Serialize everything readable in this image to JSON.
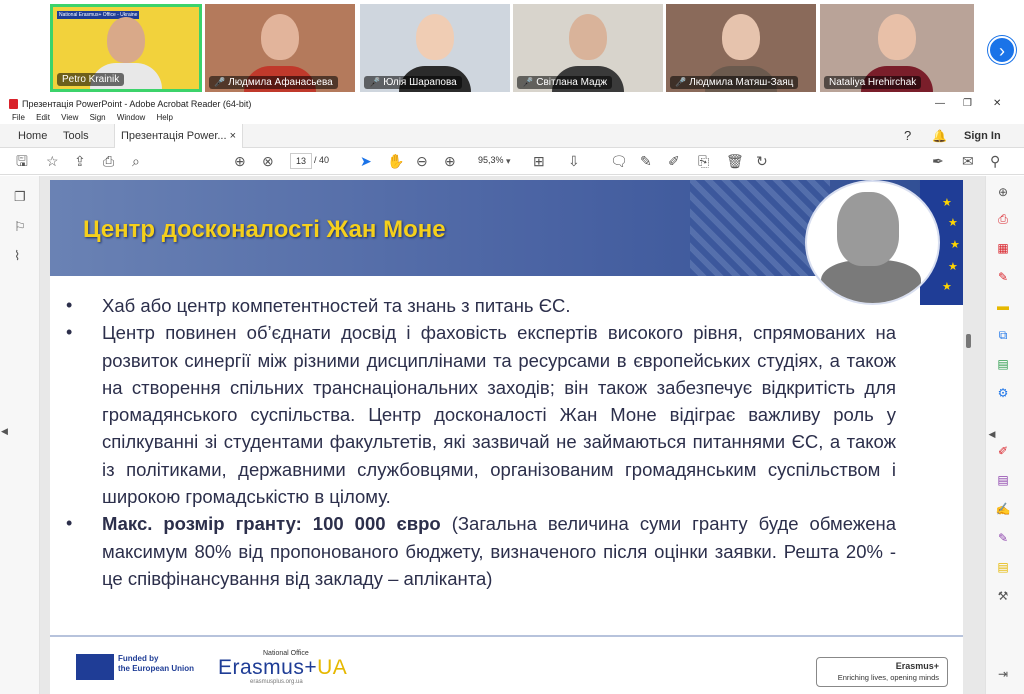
{
  "participants": [
    {
      "name": "Petro Krainik",
      "muted": false,
      "active": true,
      "bg": "#f2d23c",
      "face": "#d9a989",
      "shirt": "#e8e8e8",
      "overlay": "National Erasmus+ Office - Ukraine"
    },
    {
      "name": "Людмила Афанасьева",
      "muted": true,
      "active": false,
      "bg": "#b47a5c",
      "face": "#e2b49b",
      "shirt": "#c0392b"
    },
    {
      "name": "Юлія Шарапова",
      "muted": true,
      "active": false,
      "bg": "#cfd6de",
      "face": "#f0cdb4",
      "shirt": "#2b2b2b"
    },
    {
      "name": "Світлана Мадж",
      "muted": true,
      "active": false,
      "bg": "#d8d4cc",
      "face": "#d9b39a",
      "shirt": "#3a3a3a"
    },
    {
      "name": "Людмила Матяш-Заяц",
      "muted": true,
      "active": false,
      "bg": "#8a6a5a",
      "face": "#e6c3ad",
      "shirt": "#6b5a4e"
    },
    {
      "name": "Nataliya Hrehirchak",
      "muted": false,
      "active": false,
      "bg": "#b9a398",
      "face": "#e8c0a8",
      "shirt": "#7a1e2a"
    }
  ],
  "window": {
    "title": "Презентація PowerPoint - Adobe Acrobat Reader (64-bit)"
  },
  "menu": [
    "File",
    "Edit",
    "View",
    "Sign",
    "Window",
    "Help"
  ],
  "tabs": {
    "home": "Home",
    "tools": "Tools",
    "doc": "Презентація Power...",
    "close": "×",
    "signin": "Sign In"
  },
  "toolbar": {
    "page_current": "13",
    "page_total": "/ 40",
    "zoom": "95,3%"
  },
  "slide": {
    "title": "Центр досконалості Жан Моне",
    "bullets": [
      {
        "bold": "",
        "text": "Хаб або центр компетентностей та знань з питань ЄС."
      },
      {
        "bold": "",
        "text": "Центр повинен об’єднати досвід і фаховість експертів високого рівня, спрямованих на розвиток синергії між різними дисциплінами та ресурсами в європейських студіях, а також на створення спільних транснаціональних заходів; він також забезпечує відкритість для громадянського суспільства. Центр досконалості Жан Моне відіграє важливу роль у спілкуванні зі студентами факультетів, які зазвичай не займаються питаннями ЄС, а також із політиками, державними службовцями, організованим громадянським суспільством і широкою громадськістю в цілому."
      },
      {
        "bold": "Макс. розмір гранту: 100 000 євро",
        "text": " (Загальна величина суми гранту буде обмежена максимум 80% від пропонованого бюджету, визначеного після оцінки заявки. Решта 20% - це співфінансування від закладу – апліканта)"
      }
    ],
    "footer": {
      "eu_line1": "Funded by",
      "eu_line2": "the European Union",
      "national_office": "National Office",
      "erasmus": "Erasmus+",
      "erasmus_ua": "UA",
      "erasmus_site": "erasmusplus.org.ua",
      "badge_title": "Erasmus+",
      "badge_sub": "Enriching lives, opening minds"
    }
  },
  "colors": {
    "accent": "#1a73e8",
    "title_yellow": "#f5d01c",
    "banner_blue": "#4a63a3"
  }
}
